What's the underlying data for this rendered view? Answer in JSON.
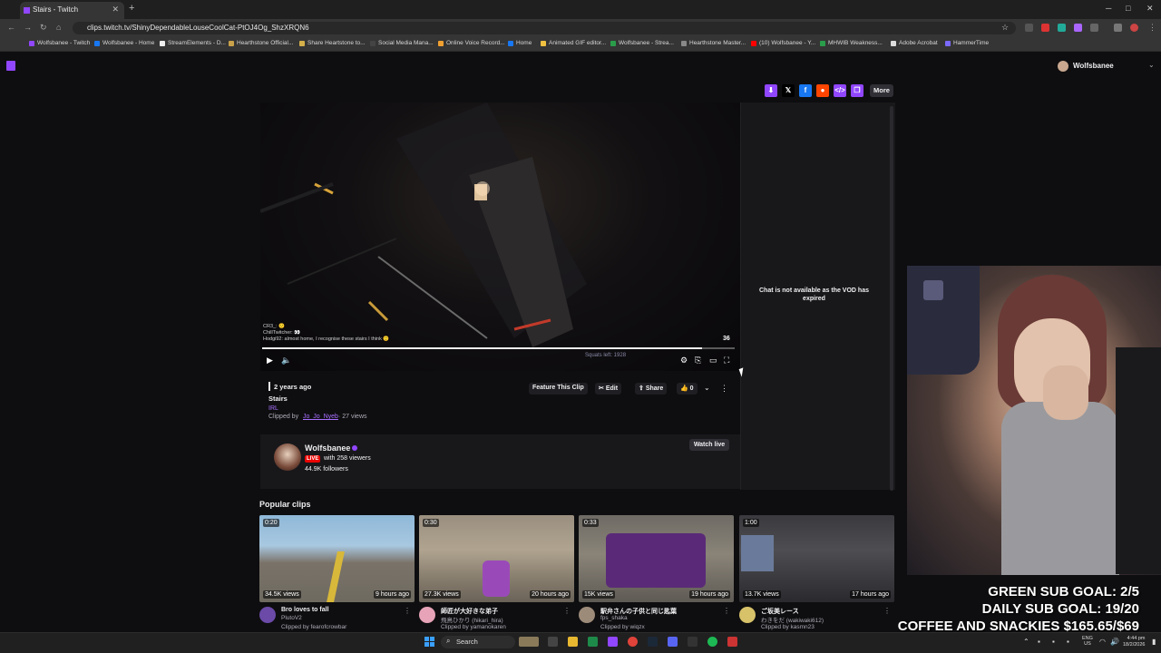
{
  "browser": {
    "tab_title": "Stairs - Twitch",
    "tab_close": "✕",
    "new_tab": "+",
    "url": "clips.twitch.tv/ShinyDependableLouseCoolCat-PtOJ4Og_ShzXRQN6",
    "bookmarks": [
      "Wolfsbanee - Twitch",
      "Wolfsbanee - Home",
      "StreamElements - D...",
      "Hearthstone Official...",
      "Share Heartstone to...",
      "Social Media Mana...",
      "Online Voice Record...",
      "Home",
      "Animated GIF editor...",
      "Wolfsbanee - Strea...",
      "Hearthstone Master...",
      "(10) Wolfsbanee - Y...",
      "MHWIB Weakness...",
      "Adobe Acrobat",
      "HammerTime"
    ]
  },
  "header": {
    "username": "Wolfsbanee"
  },
  "share": {
    "more_label": "More"
  },
  "player": {
    "overlay_number": "36",
    "progress": 0.93,
    "chat_overlay": [
      "CR3_: 🙂",
      "ChillTwitcher: 👀",
      "Hodgi92: almost home, I recognise these stairs I think 🙂"
    ],
    "hud_left": "Squats left: 1928"
  },
  "chat": {
    "message": "Chat is not available as the VOD has expired"
  },
  "clip": {
    "age": "2 years ago",
    "title": "Stairs",
    "category": "IRL",
    "clipped_by_prefix": "Clipped by",
    "clipper": "Jo_Jo_Nyeb",
    "views": "· 27 views"
  },
  "actions": {
    "feature": "Feature This Clip",
    "edit": "Edit",
    "share": "Share",
    "likes": "0"
  },
  "channel": {
    "name": "Wolfsbanee",
    "live_badge": "LIVE",
    "viewers": "with 258 viewers",
    "followers": "44.9K followers",
    "watch_live": "Watch live"
  },
  "popular": {
    "title": "Popular clips",
    "clips": [
      {
        "duration": "0:20",
        "views": "34.5K views",
        "ago": "9 hours ago",
        "title": "Bro loves to fall",
        "channel": "PlutoV2",
        "clipped_by": "Clipped by fearofcrowbar",
        "avatar_color": "#6b4aa8"
      },
      {
        "duration": "0:30",
        "views": "27.3K views",
        "ago": "20 hours ago",
        "title": "師匠が大好きな弟子",
        "channel": "飛鳥ひかり (hikari_hira)",
        "clipped_by": "Clipped by yamanokaren",
        "avatar_color": "#e7a3b8"
      },
      {
        "duration": "0:33",
        "views": "15K views",
        "ago": "19 hours ago",
        "title": "駅弁さんの子供と同じ匙葉",
        "channel": "fps_shaka",
        "clipped_by": "Clipped by wiqzx",
        "avatar_color": "#9d8b7a"
      },
      {
        "duration": "1:00",
        "views": "13.7K views",
        "ago": "17 hours ago",
        "title": "ご坂美レース",
        "channel": "わきをだ (wakiwaki612)",
        "clipped_by": "Clipped by kasmn23",
        "avatar_color": "#d7c26a"
      }
    ]
  },
  "overlay_goals": {
    "line1": "GREEN SUB GOAL: 2/5",
    "line2": "DAILY SUB GOAL: 19/20",
    "line3": "COFFEE AND SNACKIES $165.65/$69"
  },
  "taskbar": {
    "search": "Search",
    "lang_top": "ENG",
    "lang_bottom": "US",
    "time": "4:44 pm",
    "date": "18/2/2026"
  },
  "colors": {
    "twitch_purple": "#9146ff",
    "live_red": "#eb0400",
    "x_black": "#000000",
    "facebook": "#1877f2",
    "reddit": "#ff4500"
  }
}
